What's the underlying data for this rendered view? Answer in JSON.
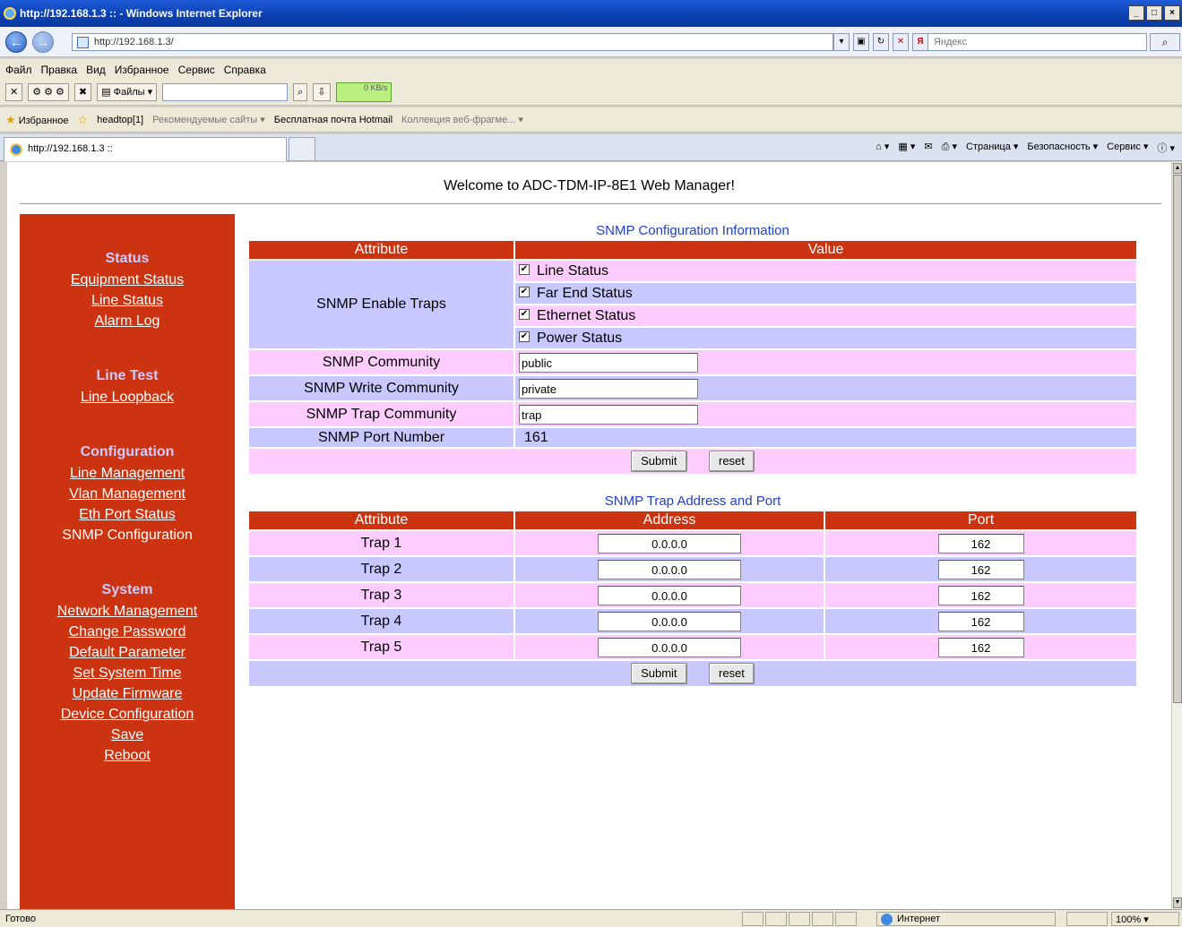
{
  "window": {
    "title": "http://192.168.1.3 :: - Windows Internet Explorer",
    "controls": [
      "_",
      "□",
      "×"
    ]
  },
  "address_bar": {
    "url": "http://192.168.1.3/",
    "search_placeholder": "Яндекс"
  },
  "menu": [
    "Файл",
    "Правка",
    "Вид",
    "Избранное",
    "Сервис",
    "Справка"
  ],
  "toolbar": {
    "files_label": "Файлы",
    "speed": "0 KB/s"
  },
  "favorites": {
    "label": "Избранное",
    "items": [
      "headtop[1]",
      "Рекомендуемые сайты ▾",
      "Бесплатная почта Hotmail",
      "Коллекция веб-фрагме... ▾"
    ]
  },
  "tab": {
    "title": "http://192.168.1.3 ::"
  },
  "command_bar": {
    "page": "Страница ▾",
    "safety": "Безопасность ▾",
    "tools": "Сервис ▾"
  },
  "page": {
    "welcome": "Welcome to ADC-TDM-IP-8E1 Web Manager!"
  },
  "sidebar": {
    "sections": [
      {
        "heading": "Status",
        "links": [
          "Equipment Status",
          "Line Status",
          "Alarm Log"
        ]
      },
      {
        "heading": "Line Test",
        "links": [
          "Line Loopback"
        ]
      },
      {
        "heading": "Configuration",
        "links": [
          "Line Management",
          "Vlan Management",
          "Eth Port Status",
          "SNMP Configuration"
        ]
      },
      {
        "heading": "System",
        "links": [
          "Network Management",
          "Change Password",
          "Default Parameter",
          "Set System Time",
          "Update Firmware",
          "Device Configuration",
          "Save",
          "Reboot"
        ]
      }
    ],
    "current": "SNMP Configuration"
  },
  "snmp_config": {
    "caption": "SNMP Configuration Information",
    "col_attribute": "Attribute",
    "col_value": "Value",
    "enable_traps_label": "SNMP Enable Traps",
    "traps": [
      {
        "label": "Line Status",
        "checked": true
      },
      {
        "label": "Far End Status",
        "checked": true
      },
      {
        "label": "Ethernet Status",
        "checked": true
      },
      {
        "label": "Power Status",
        "checked": true
      }
    ],
    "community_label": "SNMP Community",
    "community_value": "public",
    "write_community_label": "SNMP Write Community",
    "write_community_value": "private",
    "trap_community_label": "SNMP Trap Community",
    "trap_community_value": "trap",
    "port_label": "SNMP Port Number",
    "port_value": "161",
    "submit": "Submit",
    "reset": "reset"
  },
  "trap_table": {
    "caption": "SNMP Trap Address and Port",
    "col_attribute": "Attribute",
    "col_address": "Address",
    "col_port": "Port",
    "rows": [
      {
        "name": "Trap 1",
        "address": "0.0.0.0",
        "port": "162"
      },
      {
        "name": "Trap 2",
        "address": "0.0.0.0",
        "port": "162"
      },
      {
        "name": "Trap 3",
        "address": "0.0.0.0",
        "port": "162"
      },
      {
        "name": "Trap 4",
        "address": "0.0.0.0",
        "port": "162"
      },
      {
        "name": "Trap 5",
        "address": "0.0.0.0",
        "port": "162"
      }
    ],
    "submit": "Submit",
    "reset": "reset"
  },
  "statusbar": {
    "status": "Готово",
    "zone": "Интернет",
    "zoom": "100% ▾"
  },
  "colors": {
    "sidebar_bg": "#cc3311",
    "header_bg": "#cc3311",
    "row_pink": "#ffccff",
    "row_blue": "#c8c8ff",
    "caption": "#2040d0"
  }
}
